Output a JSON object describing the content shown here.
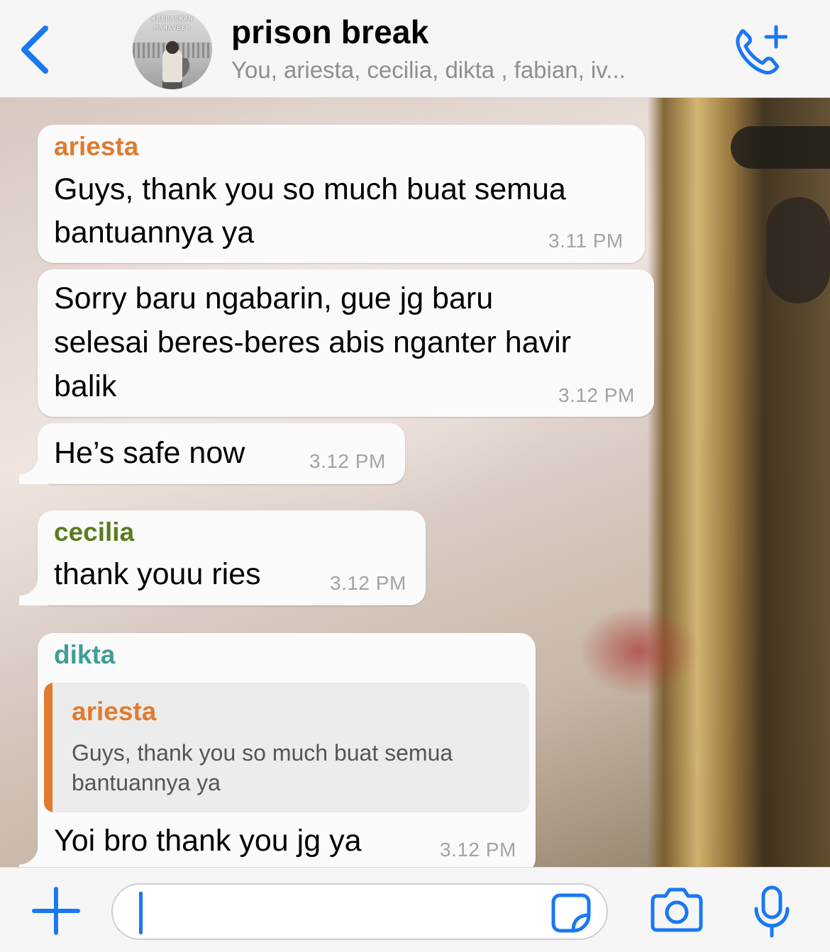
{
  "header": {
    "title": "prison break",
    "subtitle": "You, ariesta, cecilia, dikta , fabian, iv...",
    "avatar_tag_1": "#BEBASKAN",
    "avatar_tag_2": "MAHAVEER",
    "back_icon": "chevron-left-icon",
    "call_icon": "phone-plus-icon"
  },
  "colors": {
    "accent": "#1a78f2",
    "ariesta": "#e07b2f",
    "cecilia": "#5b7c1e",
    "dikta": "#3f9e97"
  },
  "messages": [
    {
      "sender": "ariesta",
      "text_line1": "Guys, thank you so much buat semua",
      "text_line2": "bantuannya ya",
      "time": "3.11 PM"
    },
    {
      "text_line1": "Sorry baru ngabarin, gue jg baru",
      "text_line2": "selesai beres-beres abis nganter havir",
      "text_line3": "balik",
      "time": "3.12 PM"
    },
    {
      "text": "He’s safe now",
      "time": "3.12 PM"
    },
    {
      "sender": "cecilia",
      "text": "thank youu ries",
      "time": "3.12 PM"
    },
    {
      "sender": "dikta",
      "quote": {
        "sender": "ariesta",
        "text": "Guys, thank you so much buat semua bantuannya ya"
      },
      "text": "Yoi bro thank you jg ya",
      "time": "3.12 PM"
    }
  ],
  "composer": {
    "value": "",
    "plus_icon": "plus-icon",
    "sticker_icon": "sticker-icon",
    "camera_icon": "camera-icon",
    "mic_icon": "microphone-icon"
  }
}
